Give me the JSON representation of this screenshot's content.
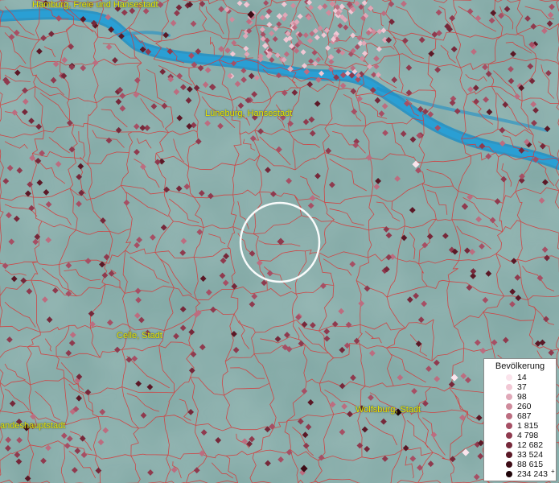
{
  "map": {
    "cities": [
      {
        "name": "Hamburg, Freie und Hansestadt"
      },
      {
        "name": "Lüneburg, Hansestadt"
      },
      {
        "name": "Celle, Stadt"
      },
      {
        "name": "Wolfsburg, Stadt"
      },
      {
        "name": "andeshauptstadt"
      }
    ],
    "colors": {
      "background": "#7fa6a3",
      "river": "#1f8fc6",
      "boundaries": "#d63a3a",
      "selection_circle": "#ffffff",
      "label": "#e9e600"
    }
  },
  "legend": {
    "title": "Bevölkerung",
    "classes": [
      {
        "value": "14",
        "color": "#fbe4ec"
      },
      {
        "value": "37",
        "color": "#f1c7d4"
      },
      {
        "value": "98",
        "color": "#e0a8b8"
      },
      {
        "value": "260",
        "color": "#cf8b9c"
      },
      {
        "value": "687",
        "color": "#bc6d80"
      },
      {
        "value": "1 815",
        "color": "#a64f64"
      },
      {
        "value": "4 798",
        "color": "#8f3a4e"
      },
      {
        "value": "12 682",
        "color": "#76283a"
      },
      {
        "value": "33 524",
        "color": "#5b1826"
      },
      {
        "value": "88 615",
        "color": "#3e0c16"
      },
      {
        "value": "234 243",
        "color": "#1f0409",
        "suffix": "+"
      }
    ]
  }
}
